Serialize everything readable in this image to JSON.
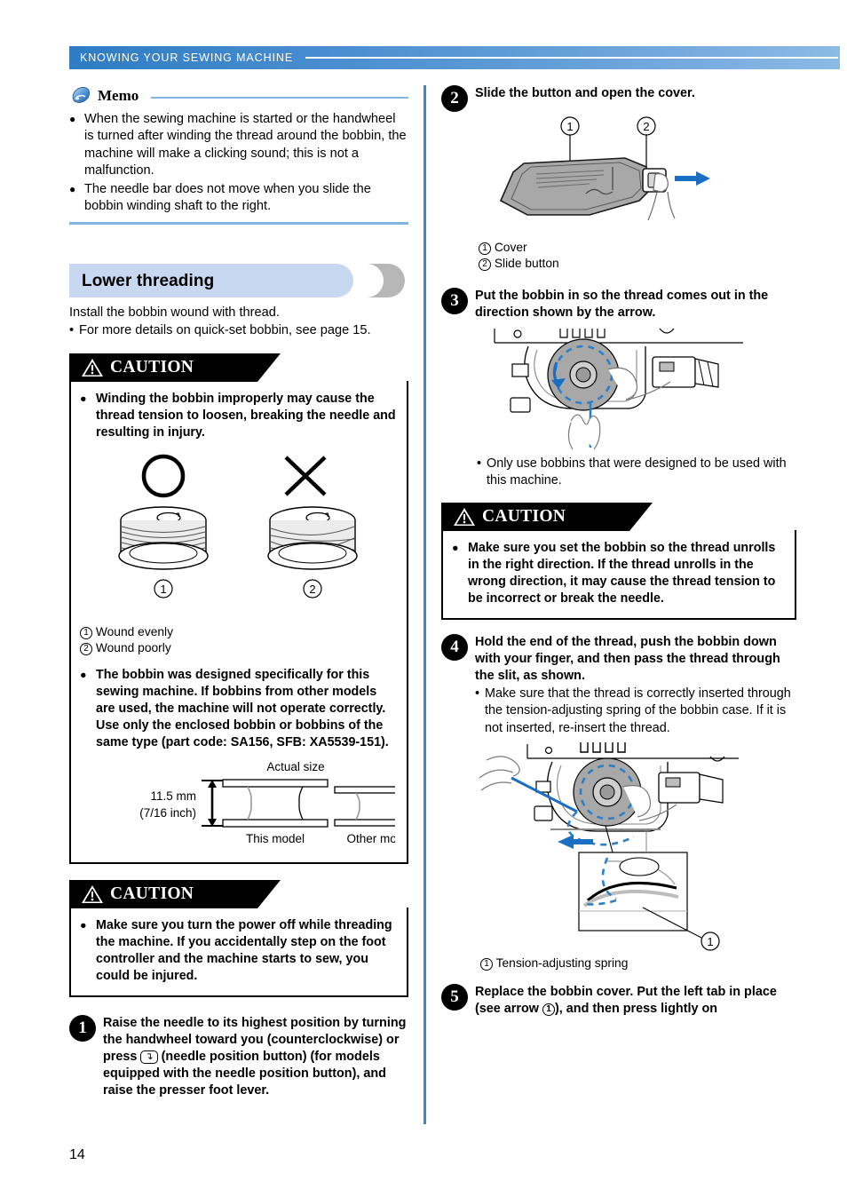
{
  "header": {
    "title": "KNOWING YOUR SEWING MACHINE"
  },
  "page_number": "14",
  "memo": {
    "title": "Memo",
    "items": [
      "When the sewing machine is started or the handwheel is turned after winding the thread around the bobbin, the machine will make a clicking sound; this is not a malfunction.",
      "The needle bar does not move when you slide the bobbin winding shaft to the right."
    ]
  },
  "section": {
    "title": "Lower threading",
    "intro": "Install the bobbin wound with thread.",
    "bullet": "For more details on quick-set bobbin, see page 15."
  },
  "caution1": {
    "label": "CAUTION",
    "items": [
      "Winding the bobbin improperly may cause the thread tension to loosen, breaking the needle and resulting in injury.",
      "The bobbin was designed specifically for this sewing machine. If bobbins from other models are used, the machine will not operate correctly. Use only the enclosed bobbin or bobbins of the same type (part code: SA156, SFB: XA5539-151)."
    ],
    "bobbin_figure": {
      "ok_mark": "circle-mark",
      "ng_mark": "cross-mark",
      "label_1": "1",
      "label_2": "2",
      "legend_1": "Wound evenly",
      "legend_2": "Wound poorly"
    },
    "size_figure": {
      "title": "Actual size",
      "dim_mm": "11.5 mm",
      "dim_inch": "(7/16 inch)",
      "left_label": "This model",
      "right_label": "Other models"
    }
  },
  "caution2": {
    "label": "CAUTION",
    "items": [
      "Make sure you turn the power off while threading the machine. If you accidentally step on the foot controller and the machine starts to sew, you could be injured."
    ]
  },
  "caution3": {
    "label": "CAUTION",
    "items": [
      "Make sure you set the bobbin so the thread unrolls in the right direction. If the thread unrolls in the wrong direction, it may cause the thread tension to be incorrect or break the needle."
    ]
  },
  "steps": {
    "step1": {
      "number": "1",
      "text_a": "Raise the needle to its highest position by turning the handwheel toward you (counterclockwise) or press",
      "button_glyph": "needle-position-button",
      "text_b": "(needle position button) (for models equipped with the needle position button), and raise the presser foot lever."
    },
    "step2": {
      "number": "2",
      "text": "Slide the button and open the cover.",
      "callout_1": "1",
      "callout_2": "2",
      "legend_1": "Cover",
      "legend_2": "Slide button"
    },
    "step3": {
      "number": "3",
      "text": "Put the bobbin in so the thread comes out in the direction shown by the arrow.",
      "note": "Only use bobbins that were designed to be used with this machine."
    },
    "step4": {
      "number": "4",
      "text": "Hold the end of the thread, push the bobbin down with your finger, and then pass the thread through the slit, as shown.",
      "note": "Make sure that the thread is correctly inserted through the tension-adjusting spring of the bobbin case. If it is not inserted, re-insert the thread.",
      "legend_1": "Tension-adjusting spring"
    },
    "step5": {
      "number": "5",
      "text_a": "Replace the bobbin cover. Put the left tab in place (see arrow",
      "callout": "1",
      "text_b": "), and then press lightly on"
    }
  },
  "colors": {
    "header_blue_start": "#2f7cc4",
    "header_blue_end": "#8cbae6",
    "divider_blue": "#3e87c8",
    "memo_rule": "#7fb6e4",
    "section_bar": "#c7d8f0",
    "section_grey": "#b7b7b7",
    "arrow_blue": "#1a6fc4",
    "thread_blue": "#2f7fc6",
    "part_grey": "#a8a8a8"
  }
}
